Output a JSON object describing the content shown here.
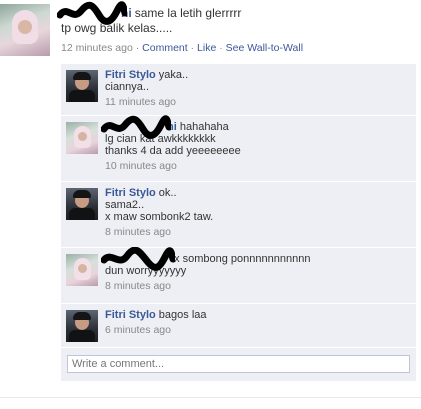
{
  "post": {
    "author_visible_suffix": "ni",
    "status_line1": "same la letih glerrrrr",
    "status_line2": "tp owg balik kelas.....",
    "time": "12 minutes ago",
    "sep": "·",
    "comment_label": "Comment",
    "like_label": "Like",
    "wall_label": "See Wall-to-Wall"
  },
  "comments": [
    {
      "author": "Fitri Stylo",
      "lines": [
        "yaka..",
        "ciannya.."
      ],
      "time": "11 minutes ago"
    },
    {
      "author_visible_suffix": "ni",
      "lines": [
        "hahahaha",
        "lg cian kat awkkkkkkkk",
        "thanks 4 da add yeeeeeeee"
      ],
      "time": "10 minutes ago"
    },
    {
      "author": "Fitri Stylo",
      "lines": [
        "ok..",
        "sama2..",
        "x maw sombonk2 taw."
      ],
      "time": "8 minutes ago"
    },
    {
      "author_visible_suffix": "",
      "lines": [
        "x sombong ponnnnnnnnnnn",
        "dun worryyyyyyy"
      ],
      "time": "8 minutes ago"
    },
    {
      "author": "Fitri Stylo",
      "lines": [
        "bagos laa"
      ],
      "time": "6 minutes ago"
    }
  ],
  "composer": {
    "placeholder": "Write a comment..."
  },
  "colors": {
    "link": "#3b5998",
    "comment_bg": "#edeff4",
    "meta_gray": "#888888",
    "redaction": "#000000"
  }
}
